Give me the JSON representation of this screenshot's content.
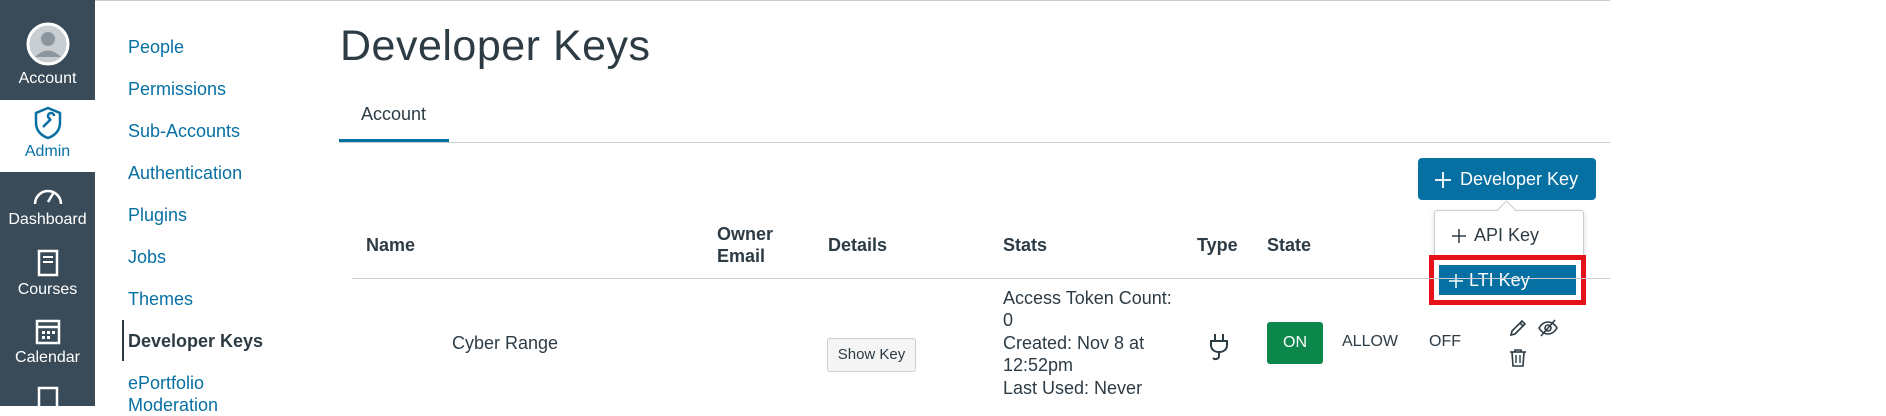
{
  "global_nav": {
    "items": [
      {
        "label": "Account",
        "icon": "avatar-icon"
      },
      {
        "label": "Admin",
        "icon": "shield-wrench-icon"
      },
      {
        "label": "Dashboard",
        "icon": "speedometer-icon"
      },
      {
        "label": "Courses",
        "icon": "book-icon"
      },
      {
        "label": "Calendar",
        "icon": "calendar-icon"
      },
      {
        "label": "",
        "icon": "inbox-icon"
      }
    ]
  },
  "sub_nav": {
    "items": [
      {
        "label": "People"
      },
      {
        "label": "Permissions"
      },
      {
        "label": "Sub-Accounts"
      },
      {
        "label": "Authentication"
      },
      {
        "label": "Plugins"
      },
      {
        "label": "Jobs"
      },
      {
        "label": "Themes"
      },
      {
        "label": "Developer Keys"
      },
      {
        "label": "ePortfolio Moderation"
      }
    ]
  },
  "page": {
    "title": "Developer Keys",
    "tab_account": "Account",
    "add_button": "Developer Key",
    "menu": {
      "api_key": "API Key",
      "lti_key": "LTI Key"
    }
  },
  "table": {
    "headers": {
      "name": "Name",
      "owner_email_1": "Owner",
      "owner_email_2": "Email",
      "details": "Details",
      "stats": "Stats",
      "type": "Type",
      "state": "State"
    },
    "rows": [
      {
        "name": "Cyber Range",
        "details_button": "Show Key",
        "stats": {
          "line1": "Access Token Count:",
          "line2": "0",
          "line3": "Created: Nov 8 at",
          "line4": "12:52pm",
          "line5": "Last Used: Never"
        },
        "type_icon": "plug-icon",
        "state": {
          "on": "ON",
          "allow": "ALLOW",
          "off": "OFF"
        }
      }
    ]
  },
  "colors": {
    "nav_bg": "#394b58",
    "link": "#0770a3",
    "primary": "#0770a3",
    "on_green": "#0b874b",
    "highlight_red": "#e5121c"
  }
}
